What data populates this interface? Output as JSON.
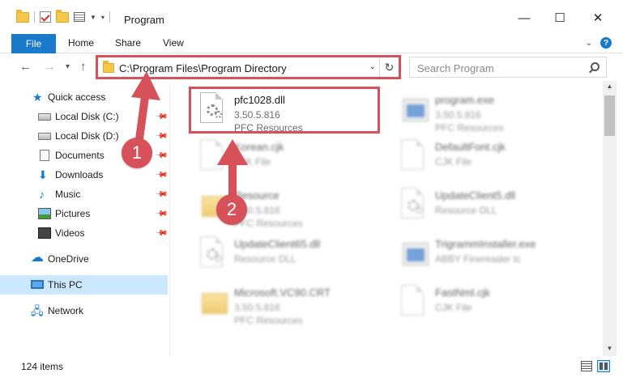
{
  "window": {
    "title": "Program",
    "minimize_glyph": "—",
    "maximize_glyph": "☐",
    "close_glyph": "✕"
  },
  "ribbon": {
    "tabs": [
      "File",
      "Home",
      "Share",
      "View"
    ]
  },
  "navigation": {
    "back_glyph": "←",
    "forward_glyph": "→",
    "recent_glyph": "▾",
    "up_glyph": "↑",
    "address": "C:\\Program Files\\Program Directory",
    "search_placeholder": "Search Program"
  },
  "sidebar": {
    "items": [
      {
        "label": "Quick access",
        "icon": "star-icon",
        "pinned": false
      },
      {
        "label": "Local Disk (C:)",
        "icon": "disk-icon",
        "pinned": true
      },
      {
        "label": "Local Disk (D:)",
        "icon": "disk-icon",
        "pinned": true
      },
      {
        "label": "Documents",
        "icon": "documents-icon",
        "pinned": true
      },
      {
        "label": "Downloads",
        "icon": "download-icon",
        "pinned": true
      },
      {
        "label": "Music",
        "icon": "music-icon",
        "pinned": true
      },
      {
        "label": "Pictures",
        "icon": "pictures-icon",
        "pinned": true
      },
      {
        "label": "Videos",
        "icon": "videos-icon",
        "pinned": true
      },
      {
        "label": "OneDrive",
        "icon": "cloud-icon",
        "pinned": false
      },
      {
        "label": "This PC",
        "icon": "computer-icon",
        "pinned": false,
        "selected": true
      },
      {
        "label": "Network",
        "icon": "network-icon",
        "pinned": false
      }
    ]
  },
  "files": [
    {
      "name": "pfc1028.dll",
      "line1": "3.50.5.816",
      "line2": "PFC Resources",
      "icon": "dll-icon"
    },
    {
      "name": "program.exe",
      "line1": "3.50.5.816",
      "line2": "PFC Resources",
      "icon": "exe-icon"
    },
    {
      "name": "Korean.cjk",
      "line1": "CJK File",
      "line2": "",
      "icon": "file-icon"
    },
    {
      "name": "DefaultFont.cjk",
      "line1": "CJK File",
      "line2": "",
      "icon": "file-icon"
    },
    {
      "name": "Resource",
      "line1": "3.50.5.816",
      "line2": "PFC Resources",
      "icon": "folder-icon"
    },
    {
      "name": "UpdateClient5.dll",
      "line1": "Resource DLL",
      "line2": "",
      "icon": "dll-icon"
    },
    {
      "name": "UpdateClient65.dll",
      "line1": "Resource DLL",
      "line2": "",
      "icon": "dll-icon"
    },
    {
      "name": "TrigrammInstaller.exe",
      "line1": "ABBY Finereader tc",
      "line2": "",
      "icon": "exe-icon"
    },
    {
      "name": "Microsoft.VC90.CRT",
      "line1": "3.50.5.816",
      "line2": "PFC Resources",
      "icon": "folder-icon"
    },
    {
      "name": "FastNml.cjk",
      "line1": "CJK File",
      "line2": "",
      "icon": "file-icon"
    }
  ],
  "status": {
    "item_count": "124 items"
  },
  "annotations": {
    "badge_1": "1",
    "badge_2": "2",
    "highlight_color": "#d65159"
  },
  "colors": {
    "accent": "#1979ca",
    "selection": "#cce8ff"
  }
}
